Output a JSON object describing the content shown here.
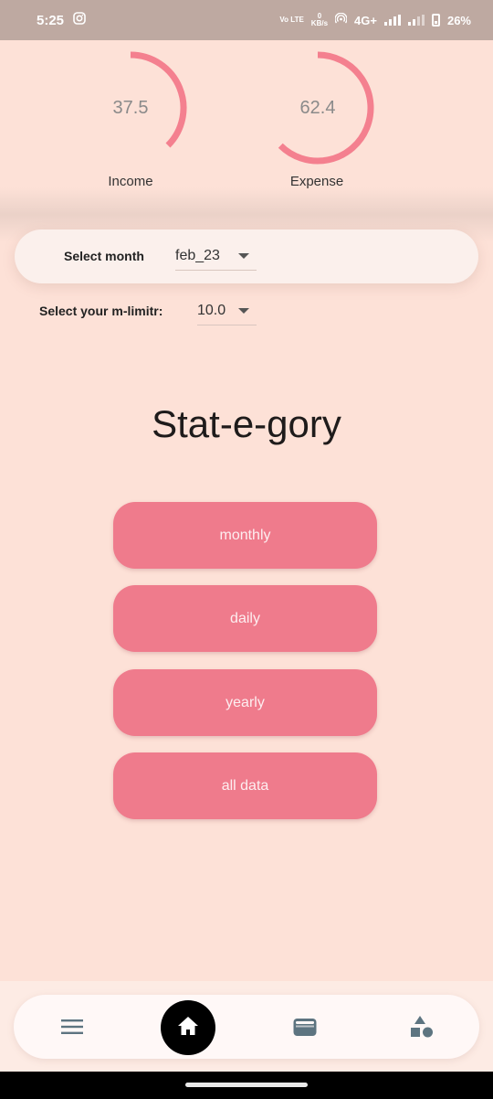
{
  "status_bar": {
    "time": "5:25",
    "network_top": "0",
    "network_bottom": "KB/s",
    "volte": "Vo LTE",
    "signal": "4G+",
    "battery": "26%"
  },
  "gauges": {
    "income": {
      "value": "37.5",
      "label": "Income",
      "fraction": 0.375
    },
    "expense": {
      "value": "62.4",
      "label": "Expense",
      "fraction": 0.624
    },
    "arc_color": "#f4808f"
  },
  "filters": {
    "month_label": "Select month",
    "month_value": "feb_23",
    "limit_label": "Select your m-limitr:",
    "limit_value": "10.0"
  },
  "title": "Stat-e-gory",
  "categories": {
    "monthly": "monthly",
    "daily": "daily",
    "yearly": "yearly",
    "all_data": "all data"
  },
  "nav": {
    "items": [
      "menu-icon",
      "home-icon",
      "wallet-icon",
      "shapes-icon"
    ],
    "active": "home-icon"
  }
}
